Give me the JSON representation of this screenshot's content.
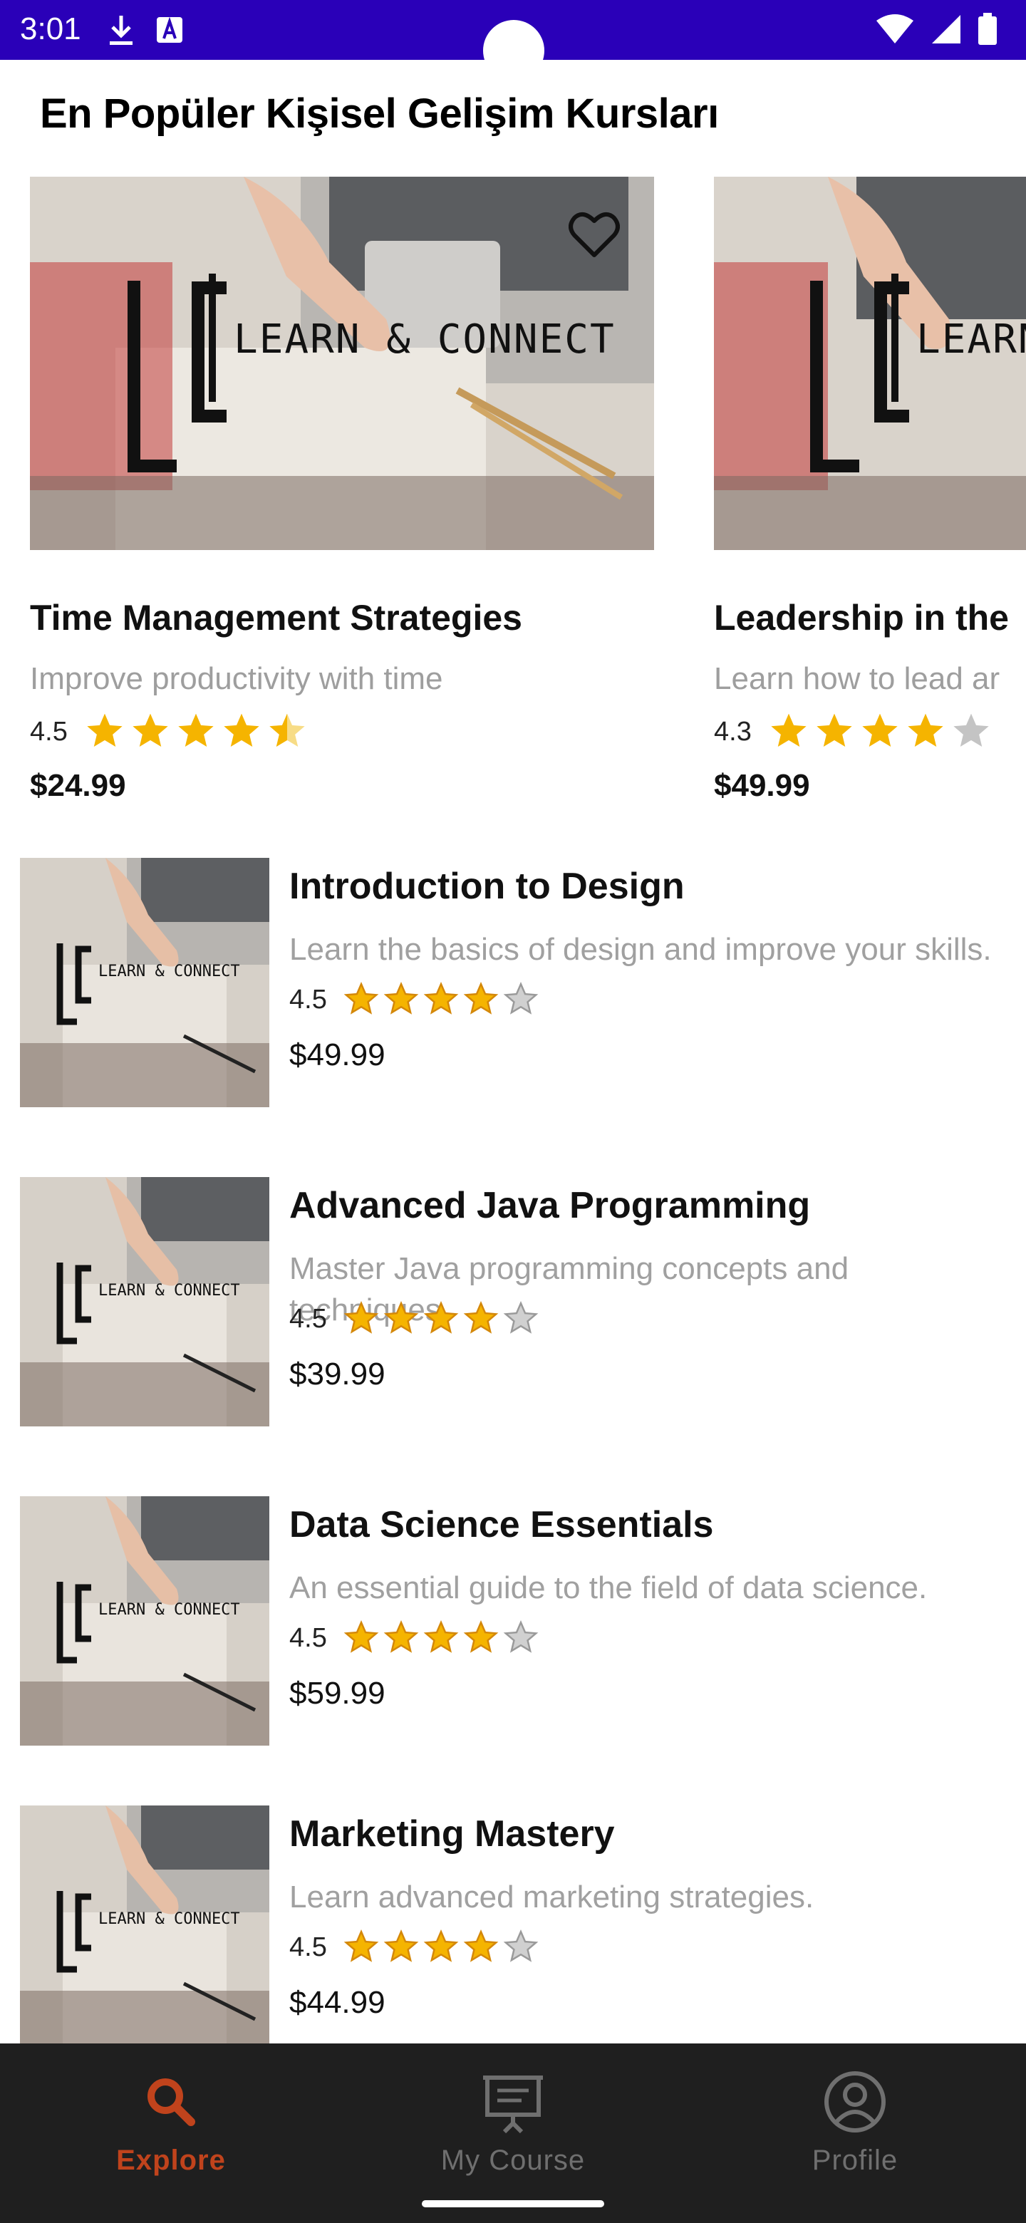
{
  "status_bar": {
    "time": "3:01",
    "bg_color": "#2a00b8",
    "icons_left": [
      "download-icon",
      "a-box-icon"
    ],
    "icons_right": [
      "wifi-icon",
      "signal-icon",
      "battery-icon"
    ]
  },
  "section_title": "En Popüler Kişisel Gelişim Kursları",
  "thumbnail_logo": {
    "mark": "LC",
    "text": "LEARN & CONNECT"
  },
  "featured": [
    {
      "title": "Time Management Strategies",
      "subtitle": "Improve productivity with time",
      "rating": "4.5",
      "rating_value": 4.5,
      "price": "$24.99",
      "favorite_icon": "heart-outline-icon"
    },
    {
      "title": "Leadership in the",
      "subtitle": "Learn how to lead ar",
      "rating": "4.3",
      "rating_value": 4.0,
      "price": "$49.99"
    }
  ],
  "courses": [
    {
      "title": "Introduction to Design",
      "description": "Learn the basics of design and improve your skills.",
      "rating": "4.5",
      "stars": 4,
      "price": "$49.99"
    },
    {
      "title": "Advanced Java Programming",
      "description": "Master Java programming concepts and techniques.",
      "rating": "4.5",
      "stars": 4,
      "price": "$39.99"
    },
    {
      "title": "Data Science Essentials",
      "description": "An essential guide to the field of data science.",
      "rating": "4.5",
      "stars": 4,
      "price": "$59.99"
    },
    {
      "title": "Marketing Mastery",
      "description": "Learn advanced marketing strategies.",
      "rating": "4.5",
      "stars": 4,
      "price": "$44.99"
    }
  ],
  "bottom_nav": {
    "active_color": "#c0431c",
    "inactive_color": "#6f6f6f",
    "items": [
      {
        "label": "Explore",
        "icon": "search-icon",
        "active": true
      },
      {
        "label": "My Course",
        "icon": "presentation-board-icon",
        "active": false
      },
      {
        "label": "Profile",
        "icon": "account-circle-icon",
        "active": false
      }
    ]
  }
}
